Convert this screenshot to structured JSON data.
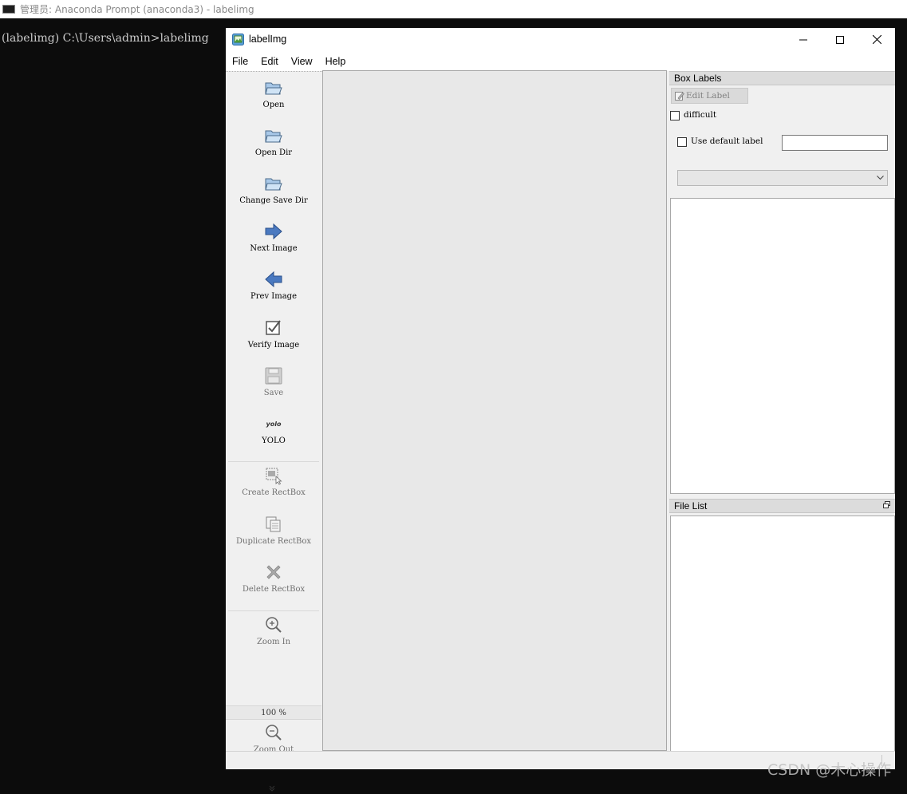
{
  "console": {
    "title": "管理员: Anaconda Prompt (anaconda3) - labelimg",
    "prompt_line": "(labelimg) C:\\Users\\admin>labelimg"
  },
  "app": {
    "title": "labelImg",
    "menu": [
      "File",
      "Edit",
      "View",
      "Help"
    ]
  },
  "toolbar": {
    "open": "Open",
    "open_dir": "Open Dir",
    "change_save_dir": "Change Save Dir",
    "next_image": "Next Image",
    "prev_image": "Prev Image",
    "verify_image": "Verify Image",
    "save": "Save",
    "yolo_icon_text": "yolo",
    "yolo": "YOLO",
    "create_rectbox": "Create RectBox",
    "duplicate_rectbox": "Duplicate RectBox",
    "delete_rectbox": "Delete RectBox",
    "zoom_in": "Zoom In",
    "zoom_value": "100 %",
    "zoom_out": "Zoom Out",
    "more": "»"
  },
  "box_labels": {
    "header": "Box Labels",
    "edit_label": "Edit Label",
    "difficult": "difficult",
    "use_default_label": "Use default label",
    "default_label_value": "",
    "combo_value": ""
  },
  "file_list": {
    "header": "File List"
  },
  "watermark": "CSDN @木心操作",
  "colors": {
    "console_bg": "#0c0c0c",
    "window_bg": "#f0f0f0",
    "canvas_bg": "#e8e8e8",
    "dock_header": "#dcdcdc",
    "arrow_blue": "#4a79c0"
  }
}
